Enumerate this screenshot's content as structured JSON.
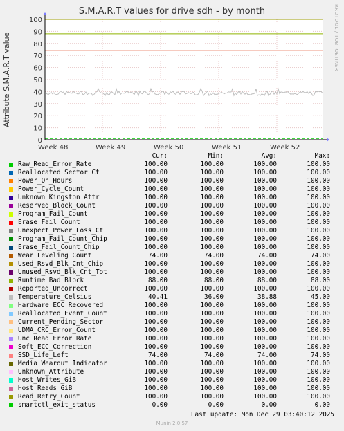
{
  "title": "S.M.A.R.T values for drive sdh - by month",
  "side_text": "RRDTOOL / TOBI OETIKER",
  "last_update": "Last update: Mon Dec 29 03:40:12 2025",
  "footer": "Munin 2.0.57",
  "headers": {
    "cur": "Cur:",
    "min": "Min:",
    "avg": "Avg:",
    "max": "Max:"
  },
  "chart_data": {
    "type": "line",
    "title": "S.M.A.R.T values for drive sdh - by month",
    "ylabel": "Attribute S.M.A.R.T value",
    "xlabel": "",
    "ylim": [
      0,
      100
    ],
    "yticks": [
      "0",
      "10",
      "20",
      "30",
      "40",
      "50",
      "60",
      "70",
      "80",
      "90",
      "100"
    ],
    "xticks": [
      "Week 48",
      "Week 49",
      "Week 50",
      "Week 51",
      "Week 52"
    ],
    "grid": true,
    "series": [
      {
        "name": "Raw_Read_Error_Rate",
        "color": "#00cc00",
        "cur": "100.00",
        "min": "100.00",
        "avg": "100.00",
        "max": "100.00"
      },
      {
        "name": "Reallocated_Sector_Ct",
        "color": "#0066b3",
        "cur": "100.00",
        "min": "100.00",
        "avg": "100.00",
        "max": "100.00"
      },
      {
        "name": "Power_On_Hours",
        "color": "#ff8000",
        "cur": "100.00",
        "min": "100.00",
        "avg": "100.00",
        "max": "100.00"
      },
      {
        "name": "Power_Cycle_Count",
        "color": "#ffcc00",
        "cur": "100.00",
        "min": "100.00",
        "avg": "100.00",
        "max": "100.00"
      },
      {
        "name": "Unknown_Kingston_Attr",
        "color": "#330099",
        "cur": "100.00",
        "min": "100.00",
        "avg": "100.00",
        "max": "100.00"
      },
      {
        "name": "Reserved_Block_Count",
        "color": "#990099",
        "cur": "100.00",
        "min": "100.00",
        "avg": "100.00",
        "max": "100.00"
      },
      {
        "name": "Program_Fail_Count",
        "color": "#ccff00",
        "cur": "100.00",
        "min": "100.00",
        "avg": "100.00",
        "max": "100.00"
      },
      {
        "name": "Erase_Fail_Count",
        "color": "#ff0000",
        "cur": "100.00",
        "min": "100.00",
        "avg": "100.00",
        "max": "100.00"
      },
      {
        "name": "Unexpect_Power_Loss_Ct",
        "color": "#808080",
        "cur": "100.00",
        "min": "100.00",
        "avg": "100.00",
        "max": "100.00"
      },
      {
        "name": "Program_Fail_Count_Chip",
        "color": "#008f00",
        "cur": "100.00",
        "min": "100.00",
        "avg": "100.00",
        "max": "100.00"
      },
      {
        "name": "Erase_Fail_Count_Chip",
        "color": "#00487d",
        "cur": "100.00",
        "min": "100.00",
        "avg": "100.00",
        "max": "100.00"
      },
      {
        "name": "Wear_Leveling_Count",
        "color": "#b35a00",
        "cur": "74.00",
        "min": "74.00",
        "avg": "74.00",
        "max": "74.00"
      },
      {
        "name": "Used_Rsvd_Blk_Cnt_Chip",
        "color": "#b38f00",
        "cur": "100.00",
        "min": "100.00",
        "avg": "100.00",
        "max": "100.00"
      },
      {
        "name": "Unused_Rsvd_Blk_Cnt_Tot",
        "color": "#6b006b",
        "cur": "100.00",
        "min": "100.00",
        "avg": "100.00",
        "max": "100.00"
      },
      {
        "name": "Runtime_Bad_Block",
        "color": "#8fb300",
        "cur": "88.00",
        "min": "88.00",
        "avg": "88.00",
        "max": "88.00"
      },
      {
        "name": "Reported_Uncorrect",
        "color": "#b30000",
        "cur": "100.00",
        "min": "100.00",
        "avg": "100.00",
        "max": "100.00"
      },
      {
        "name": "Temperature_Celsius",
        "color": "#bebebe",
        "cur": "40.41",
        "min": "36.00",
        "avg": "38.88",
        "max": "45.00"
      },
      {
        "name": "Hardware_ECC_Recovered",
        "color": "#80ff80",
        "cur": "100.00",
        "min": "100.00",
        "avg": "100.00",
        "max": "100.00"
      },
      {
        "name": "Reallocated_Event_Count",
        "color": "#80c9ff",
        "cur": "100.00",
        "min": "100.00",
        "avg": "100.00",
        "max": "100.00"
      },
      {
        "name": "Current_Pending_Sector",
        "color": "#ffc080",
        "cur": "100.00",
        "min": "100.00",
        "avg": "100.00",
        "max": "100.00"
      },
      {
        "name": "UDMA_CRC_Error_Count",
        "color": "#ffe680",
        "cur": "100.00",
        "min": "100.00",
        "avg": "100.00",
        "max": "100.00"
      },
      {
        "name": "Unc_Read_Error_Rate",
        "color": "#aa80ff",
        "cur": "100.00",
        "min": "100.00",
        "avg": "100.00",
        "max": "100.00"
      },
      {
        "name": "Soft_ECC_Correction",
        "color": "#ee00cc",
        "cur": "100.00",
        "min": "100.00",
        "avg": "100.00",
        "max": "100.00"
      },
      {
        "name": "SSD_Life_Left",
        "color": "#ff8080",
        "cur": "74.00",
        "min": "74.00",
        "avg": "74.00",
        "max": "74.00"
      },
      {
        "name": "Media_Wearout_Indicator",
        "color": "#666600",
        "cur": "100.00",
        "min": "100.00",
        "avg": "100.00",
        "max": "100.00"
      },
      {
        "name": "Unknown_Attribute",
        "color": "#ffbfff",
        "cur": "100.00",
        "min": "100.00",
        "avg": "100.00",
        "max": "100.00"
      },
      {
        "name": "Host_Writes_GiB",
        "color": "#00ffcc",
        "cur": "100.00",
        "min": "100.00",
        "avg": "100.00",
        "max": "100.00"
      },
      {
        "name": "Host_Reads_GiB",
        "color": "#cc6699",
        "cur": "100.00",
        "min": "100.00",
        "avg": "100.00",
        "max": "100.00"
      },
      {
        "name": "Read_Retry_Count",
        "color": "#999900",
        "cur": "100.00",
        "min": "100.00",
        "avg": "100.00",
        "max": "100.00"
      },
      {
        "name": "smartctl_exit_status",
        "color": "#00cc00",
        "cur": "0.00",
        "min": "0.00",
        "avg": "0.00",
        "max": "0.00"
      }
    ]
  }
}
